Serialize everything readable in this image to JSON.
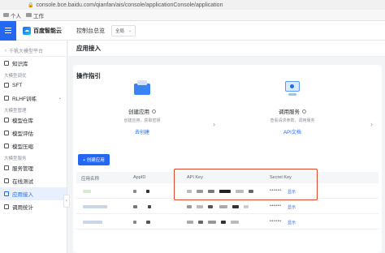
{
  "browser": {
    "url": "console.bce.baidu.com/qianfan/ais/console/applicationConsole/application",
    "bookmarks": [
      {
        "label": "个人"
      },
      {
        "label": "工作"
      }
    ]
  },
  "header": {
    "logo_text": "百度智能云",
    "console_label": "控制台总览",
    "region": "全局"
  },
  "sidebar": {
    "product": "千帆大模型平台",
    "items": [
      {
        "type": "item",
        "label": "知识库"
      },
      {
        "type": "group",
        "label": "大模型调优"
      },
      {
        "type": "item",
        "label": "SFT"
      },
      {
        "type": "item",
        "label": "RLHF训练",
        "chevron": true
      },
      {
        "type": "group",
        "label": "大模型管理"
      },
      {
        "type": "item",
        "label": "模型仓库"
      },
      {
        "type": "item",
        "label": "模型评估"
      },
      {
        "type": "item",
        "label": "模型压缩"
      },
      {
        "type": "group",
        "label": "大模型服务"
      },
      {
        "type": "item",
        "label": "服务管理"
      },
      {
        "type": "item",
        "label": "在线测试"
      },
      {
        "type": "item",
        "label": "应用接入",
        "active": true
      },
      {
        "type": "item",
        "label": "调用统计"
      }
    ]
  },
  "main": {
    "title": "应用接入",
    "guide": {
      "title": "操作指引",
      "steps": [
        {
          "name": "创建应用",
          "desc": "创建应用，获取密钥",
          "link": "去创建"
        },
        {
          "name": "调用服务",
          "desc": "查看请求参数，调用服务",
          "link": "API文档"
        }
      ]
    },
    "apps": {
      "create_button": "+ 创建应用",
      "columns": [
        "应用名称",
        "AppID",
        "API Key",
        "Secret Key"
      ],
      "rows": [
        {
          "secret_mask": "••••••",
          "show_label": "显示"
        },
        {
          "secret_mask": "••••••",
          "show_label": "显示"
        },
        {
          "secret_mask": "••••••",
          "show_label": "显示"
        }
      ]
    }
  },
  "colors": {
    "accent": "#2468f2",
    "highlight": "#e0472a"
  }
}
